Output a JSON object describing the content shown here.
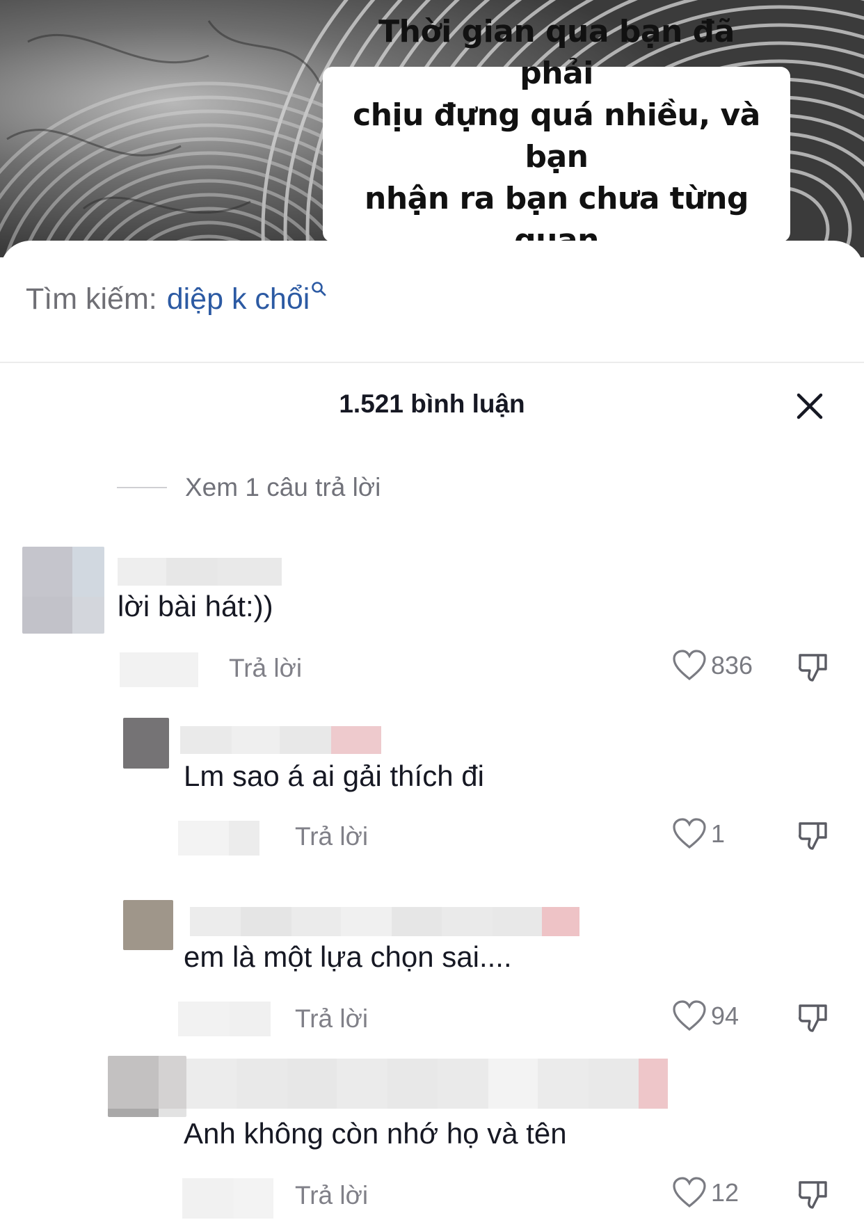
{
  "video": {
    "caption": "Thời gian qua bạn đã phải\nchịu đựng quá nhiều, và bạn\nnhận ra bạn chưa từng quan\ntâm bản thân mình..."
  },
  "search": {
    "prefix": "Tìm kiếm:",
    "term": "diệp k chổi",
    "icon": "search-icon"
  },
  "header": {
    "comment_count": "1.521 bình luận",
    "close_icon": "close-icon"
  },
  "view_replies": "Xem 1 câu trả lời",
  "comments": [
    {
      "text": "lời bài hát:))",
      "reply_label": "Trả lời",
      "likes": "836"
    },
    {
      "text": "Lm sao á ai gải thích đi",
      "reply_label": "Trả lời",
      "likes": "1"
    },
    {
      "text": "em là một lựa chọn sai....",
      "reply_label": "Trả lời",
      "likes": "94"
    },
    {
      "text": "Anh không còn nhớ họ và tên",
      "reply_label": "Trả lời",
      "likes": "12"
    }
  ],
  "colors": {
    "search_term": "#2c5aa3",
    "muted_text": "#808088",
    "heart_outline": "#7a7b82"
  }
}
